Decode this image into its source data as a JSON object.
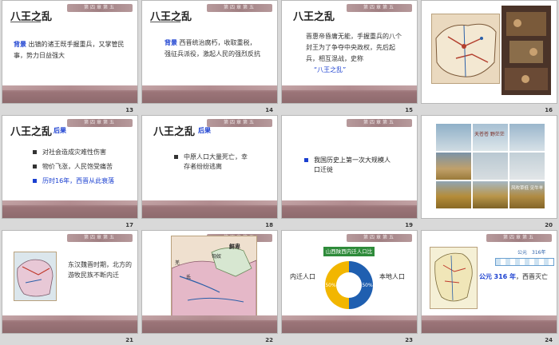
{
  "slides": [
    {
      "num": "13",
      "title": "八王之乱",
      "tag": "背景",
      "text": "出镇的诸王既手握重兵，又掌管民事，势力日益强大",
      "banner": "第四章第五"
    },
    {
      "num": "14",
      "title": "八王之乱",
      "tag": "背景",
      "text": "西晋统治腐朽，收取重税，强征兵派役，激起人民的强烈反抗",
      "banner": "第四章第五"
    },
    {
      "num": "15",
      "title": "八王之乱",
      "text": "晋惠帝昏庸无能，手握重兵的八个封王为了争夺中央政权，先后起兵，相互混战，史称",
      "quote": "“八王之乱”",
      "banner": "第四章第五"
    },
    {
      "num": "16"
    },
    {
      "num": "17",
      "title": "八王之乱",
      "tag": "后果",
      "bullets": [
        "对社会造成灾难性伤害",
        "物价飞涨，人民饱受痛苦",
        "历时16年，西晋从此衰落"
      ],
      "banner": "第四章第五"
    },
    {
      "num": "18",
      "title": "八王之乱",
      "tag": "后果",
      "bullets": [
        "中原人口大量死亡，幸存者纷纷逃离"
      ],
      "banner": "第四章第五"
    },
    {
      "num": "19",
      "bullets": [
        "我国历史上第一次大规模人口迁徙"
      ],
      "banner": "第四章第五"
    },
    {
      "num": "20",
      "photo_labels": [
        "天苍苍 野茫茫",
        "风吹草低 见牛羊"
      ]
    },
    {
      "num": "21",
      "text": "东汉魏晋时期，北方的游牧民族不断内迁",
      "banner": "第四章第五"
    },
    {
      "num": "22",
      "map_labels": [
        "鲜卑",
        "匈奴",
        "羌",
        "氐"
      ],
      "banner": "第四章第五"
    },
    {
      "num": "23",
      "chart_title": "山西陕西内迁人口比例",
      "left_label": "内迁人口",
      "right_label": "本地人口",
      "left_pct": "50%",
      "right_pct": "50%",
      "banner": "第四章第五"
    },
    {
      "num": "24",
      "timeline_year": "公元",
      "year_value": "316 年",
      "caption": "，西晋灭亡",
      "badge": "公元",
      "badge2": "316年",
      "banner": "第四章第五"
    }
  ],
  "chart_data": {
    "type": "pie",
    "title": "山西陕西内迁人口比例",
    "categories": [
      "内迁人口",
      "本地人口"
    ],
    "values": [
      50,
      50
    ],
    "colors": [
      "#1f5fb0",
      "#f2b600"
    ]
  }
}
